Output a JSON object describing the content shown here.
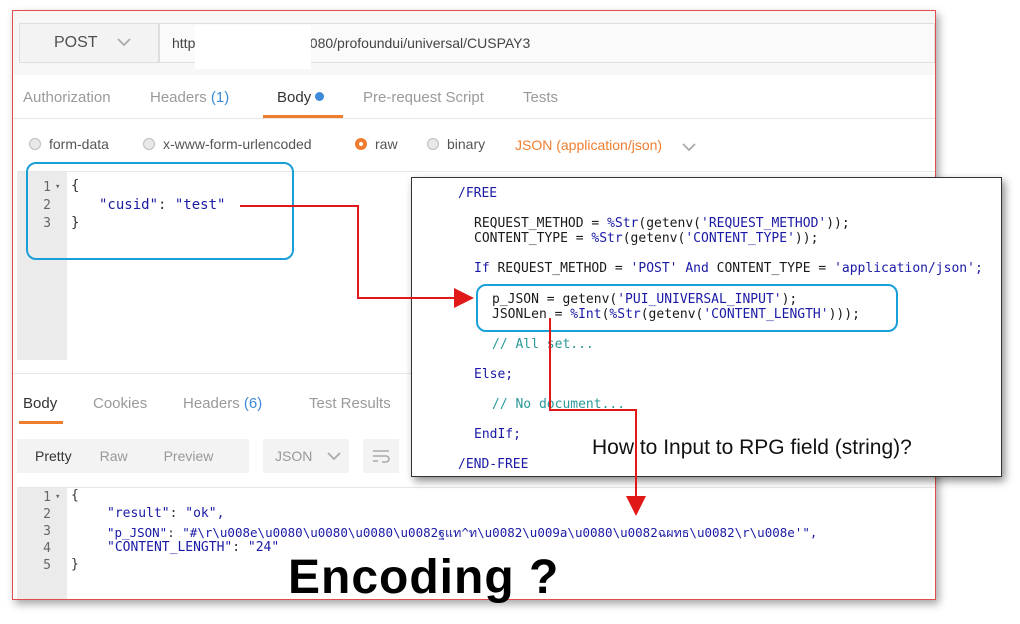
{
  "request": {
    "method": "POST",
    "url_start": "http",
    "url_end": "8080/profoundui/universal/CUSPAY3"
  },
  "tabs": [
    {
      "label": "Authorization"
    },
    {
      "label": "Headers",
      "count": "(1)"
    },
    {
      "label": "Body"
    },
    {
      "label": "Pre-request Script"
    },
    {
      "label": "Tests"
    }
  ],
  "body_options": [
    {
      "label": "form-data",
      "selected": false
    },
    {
      "label": "x-www-form-urlencoded",
      "selected": false
    },
    {
      "label": "raw",
      "selected": true
    },
    {
      "label": "binary",
      "selected": false
    }
  ],
  "content_type": "JSON (application/json)",
  "request_body": {
    "line_numbers": [
      "1",
      "2",
      "3"
    ],
    "open": "{",
    "key": "\"cusid\"",
    "colon": ": ",
    "value": "\"test\"",
    "close": "}"
  },
  "response_tabs": [
    {
      "label": "Body"
    },
    {
      "label": "Cookies"
    },
    {
      "label": "Headers",
      "count": "(6)"
    },
    {
      "label": "Test Results"
    }
  ],
  "response_view": {
    "pretty": "Pretty",
    "raw": "Raw",
    "preview": "Preview",
    "format": "JSON"
  },
  "response_body": {
    "line_numbers": [
      "1",
      "2",
      "3",
      "4",
      "5"
    ],
    "open": "{",
    "result_key": "\"result\"",
    "result_val": "\"ok\",",
    "pjson_key": "\"p_JSON\"",
    "pjson_val": "\"#\\r\\u008e\\u0080\\u0080\\u0080\\u0082ฐแท^ท\\u0082\\u009a\\u0080\\u0082ฉผทธ\\u0082\\r\\u008e'\",",
    "len_key": "\"CONTENT_LENGTH\"",
    "len_val": "\"24\"",
    "close": "}"
  },
  "rpg_code": {
    "free": "/FREE",
    "l1a": "REQUEST_METHOD = ",
    "l1b": "%Str",
    "l1c": "(getenv(",
    "l1d": "'REQUEST_METHOD'",
    "l1e": "));",
    "l2a": "CONTENT_TYPE = ",
    "l2b": "%Str",
    "l2c": "(getenv(",
    "l2d": "'CONTENT_TYPE'",
    "l2e": "));",
    "l3a": "If",
    "l3b": " REQUEST_METHOD = ",
    "l3c": "'POST'",
    "l3d": " And",
    "l3e": " CONTENT_TYPE = ",
    "l3f": "'application/json';",
    "l4a": "p_JSON = getenv(",
    "l4b": "'PUI_UNIVERSAL_INPUT'",
    "l4c": ");",
    "l5a": "JSONLen = ",
    "l5b": "%Int",
    "l5c": "(",
    "l5d": "%Str",
    "l5e": "(getenv(",
    "l5f": "'CONTENT_LENGTH'",
    "l5g": ")));",
    "c1": "// All set...",
    "else": "Else;",
    "c2": "// No document...",
    "endif": "EndIf;",
    "endfree": "/END-FREE"
  },
  "annotation_question": "How to Input to RPG field (string)?",
  "annotation_title": "Encoding ?"
}
